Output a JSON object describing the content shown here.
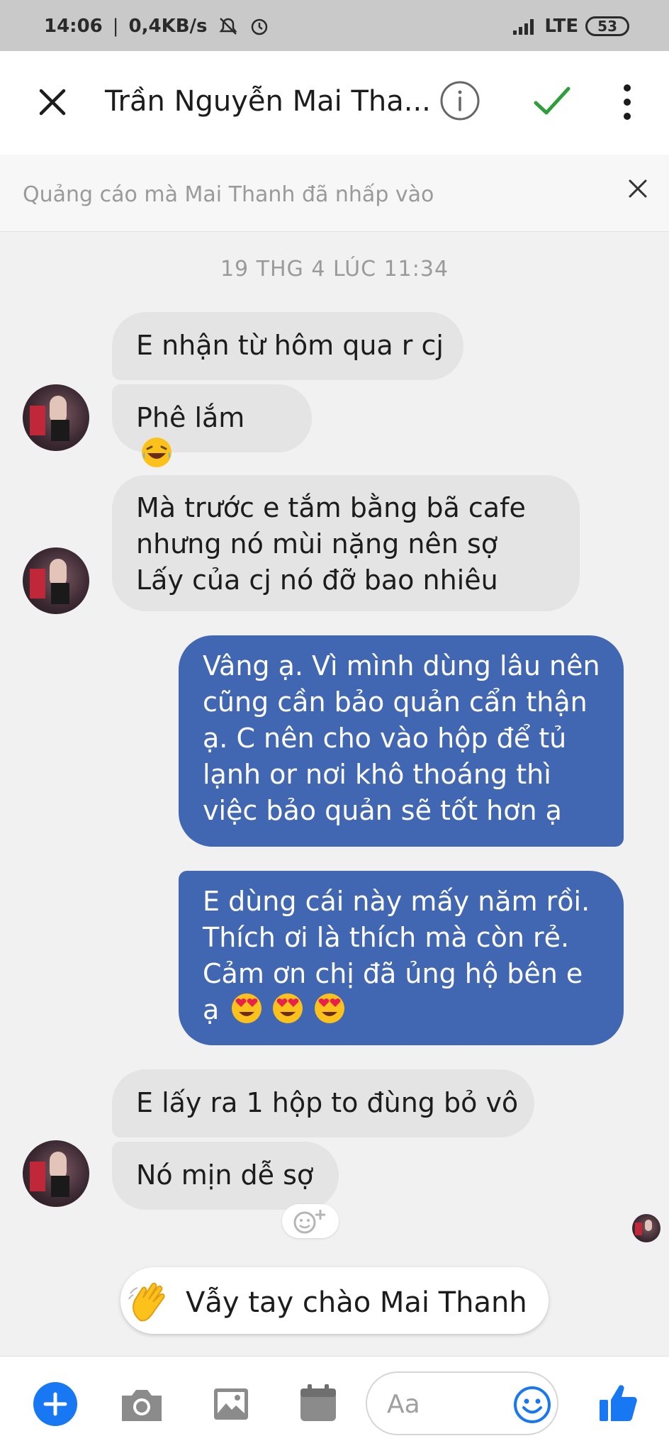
{
  "status_bar": {
    "time": "14:06",
    "network_speed": "0,4KB/s",
    "signal": "LTE",
    "battery": "53"
  },
  "header": {
    "contact_name": "Trần Nguyễn Mai Tha..."
  },
  "ad_banner": {
    "text": "Quảng cáo mà Mai Thanh đã nhấp vào"
  },
  "date_separator": "19 THG 4 LÚC 11:34",
  "messages": [
    {
      "sender": "them",
      "lines": [
        "E nhận từ hôm qua r cj"
      ]
    },
    {
      "sender": "them",
      "lines": [
        "Phê lắm"
      ]
    },
    {
      "sender": "them",
      "lines": [
        "Mà trước e tắm bằng bã cafe",
        "nhưng nó mùi nặng nên sợ",
        "Lấy của cj nó đỡ bao nhiêu"
      ]
    },
    {
      "sender": "me",
      "lines": [
        "Vâng ạ. Vì mình dùng lâu nên",
        "cũng cần bảo quản cẩn thận",
        "ạ. C nên cho vào hộp để tủ",
        "lạnh or nơi khô thoáng thì",
        "việc bảo quản sẽ tốt hơn ạ"
      ]
    },
    {
      "sender": "me",
      "lines": [
        "E dùng cái này mấy năm rồi.",
        "Thích ơi là thích mà còn rẻ.",
        "Cảm ơn chị đã ủng hộ bên e",
        "ạ"
      ]
    },
    {
      "sender": "them",
      "lines": [
        "E lấy ra 1 hộp to đùng bỏ vô"
      ]
    },
    {
      "sender": "them",
      "lines": [
        "Nó mịn dễ sợ"
      ]
    }
  ],
  "wave_button": {
    "label": "Vẫy tay chào Mai Thanh"
  },
  "composer": {
    "placeholder": "Aa"
  },
  "colors": {
    "outgoing_bubble": "#4267b2",
    "incoming_bubble": "#e4e4e4",
    "accent_blue": "#1877f2",
    "check_green": "#2e9e3a"
  },
  "icons": [
    "close-icon",
    "info-icon",
    "check-icon",
    "more-vertical-icon",
    "plus-icon",
    "camera-icon",
    "image-icon",
    "calendar-icon",
    "smiley-icon",
    "thumbs-up-icon",
    "wave-hand-icon",
    "add-reaction-icon"
  ]
}
